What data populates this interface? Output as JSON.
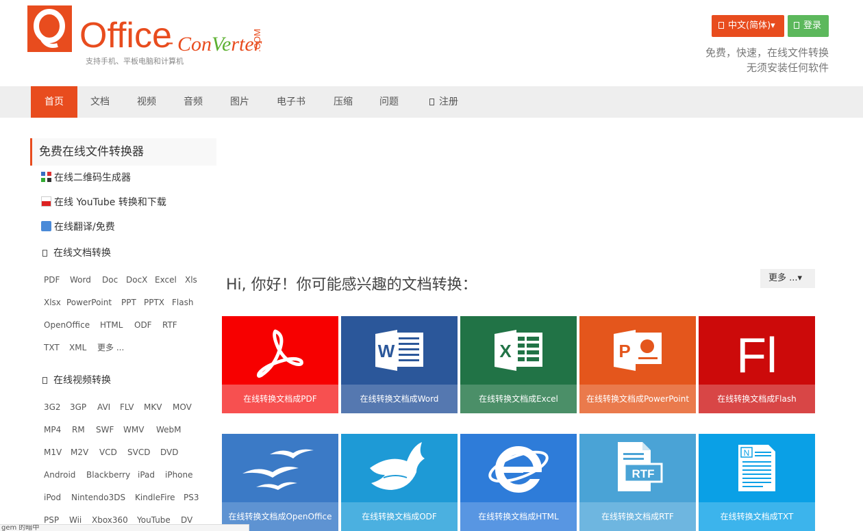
{
  "header": {
    "logo_o": "O",
    "logo_office": "ffice",
    "logo_dash": "-",
    "logo_con": "Con",
    "logo_ve": "Ve",
    "logo_rter": "rter",
    "logo_com": ".COM",
    "tagline_sub": "支持手机、平板电脑和计算机",
    "lang_button": "中文(简体)▾",
    "login_button": "登录",
    "slogan_1": "免费，快速，在线文件转换",
    "slogan_2": "无须安装任何软件",
    "brand_color": "#e84c1e"
  },
  "nav": {
    "items": [
      "首页",
      "文档",
      "视频",
      "音频",
      "图片",
      "电子书",
      "压缩",
      "问题",
      "注册"
    ]
  },
  "sidebar": {
    "title": "免费在线文件转换器",
    "links": [
      "在线二维码生成器",
      "在线 YouTube 转换和下载",
      "在线翻译/免费"
    ],
    "doc_section": "在线文档转换",
    "doc_formats": [
      [
        "PDF",
        "Word",
        "Doc",
        "DocX",
        "Excel",
        "Xls"
      ],
      [
        "Xlsx",
        "PowerPoint",
        "PPT",
        "PPTX",
        "Flash"
      ],
      [
        "OpenOffice",
        "HTML",
        "ODF",
        "RTF"
      ],
      [
        "TXT",
        "XML",
        "更多 ..."
      ]
    ],
    "video_section": "在线视频转换",
    "video_formats": [
      [
        "3G2",
        "3GP",
        "AVI",
        "FLV",
        "MKV",
        "MOV"
      ],
      [
        "MP4",
        "RM",
        "SWF",
        "WMV",
        "WebM"
      ],
      [
        "M1V",
        "M2V",
        "VCD",
        "SVCD",
        "DVD"
      ],
      [
        "Android",
        "Blackberry",
        "iPad",
        "iPhone"
      ],
      [
        "iPod",
        "Nintendo3DS",
        "KindleFire",
        "PS3"
      ],
      [
        "PSP",
        "Wii",
        "Xbox360",
        "YouTube",
        "DV"
      ]
    ]
  },
  "main": {
    "greeting": "Hi, 你好！你可能感兴趣的文档转换：",
    "more_button": "更多 ...▾",
    "tiles_row1": [
      {
        "caption": "在线转换文档成PDF",
        "bg": "#f70000",
        "cap_bg": "#f75050",
        "icon": "acrobat-icon"
      },
      {
        "caption": "在线转换文档成Word",
        "bg": "#2b579a",
        "cap_bg": "#5578b0",
        "icon": "word-icon",
        "letter": "W"
      },
      {
        "caption": "在线转换文档成Excel",
        "bg": "#217346",
        "cap_bg": "#4b8f68",
        "icon": "excel-icon",
        "letter": "X"
      },
      {
        "caption": "在线转换文档成PowerPoint",
        "bg": "#e4561c",
        "cap_bg": "#ea7a4c",
        "icon": "powerpoint-icon",
        "letter": "P"
      },
      {
        "caption": "在线转换文档成Flash",
        "bg": "#cc0a0a",
        "cap_bg": "#d84646",
        "icon": "flash-icon",
        "letter": "Fl"
      }
    ],
    "tiles_row2": [
      {
        "caption": "在线转换文档成OpenOffice",
        "bg": "#3b7ac6",
        "cap_bg": "#5e93d2",
        "icon": "openoffice-gulls-icon"
      },
      {
        "caption": "在线转换文档成ODF",
        "bg": "#1e9ad6",
        "cap_bg": "#4bb0e0",
        "icon": "dove-book-icon"
      },
      {
        "caption": "在线转换文档成HTML",
        "bg": "#2e7cd9",
        "cap_bg": "#5896e2",
        "icon": "internet-explorer-icon"
      },
      {
        "caption": "在线转换文档成RTF",
        "bg": "#4aa3d6",
        "cap_bg": "#6eb6e0",
        "icon": "rtf-doc-icon",
        "letter": "RTF"
      },
      {
        "caption": "在线转换文档成TXT",
        "bg": "#0aa0e6",
        "cap_bg": "#3cb4ec",
        "icon": "txt-doc-icon",
        "letter": "N"
      }
    ]
  },
  "footer": {
    "status_text": "gem 的暗中"
  }
}
